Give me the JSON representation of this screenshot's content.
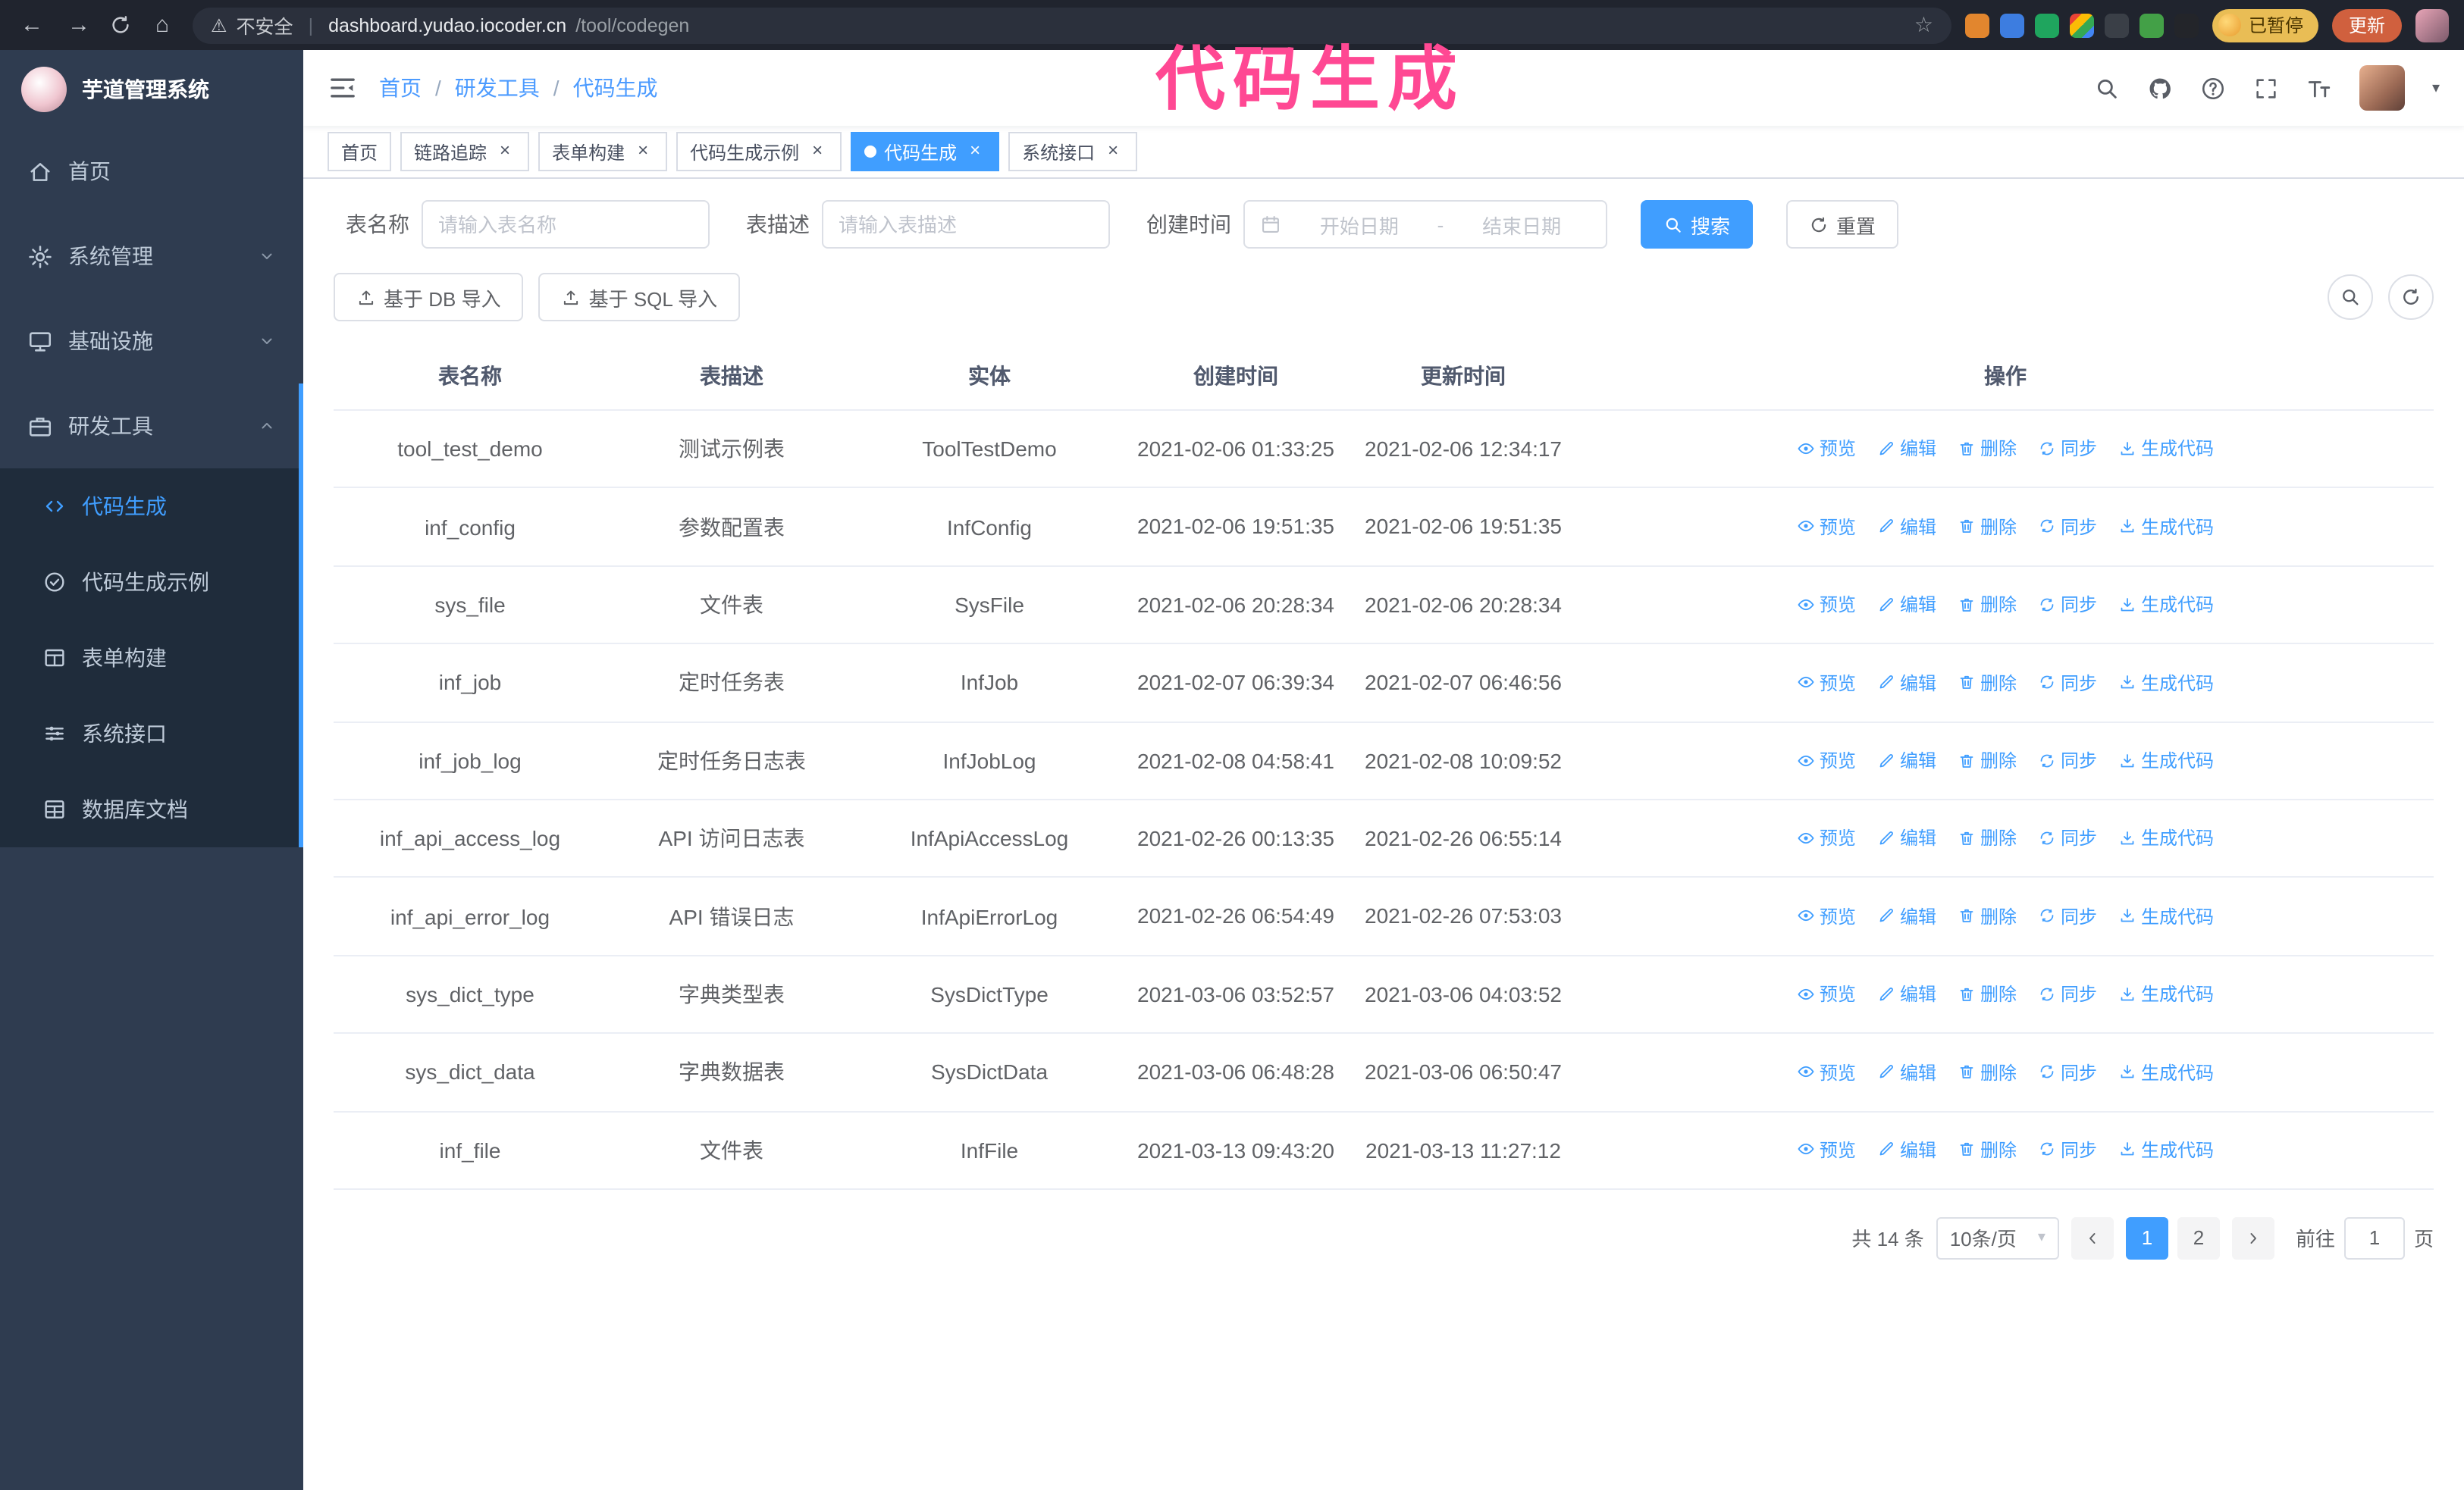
{
  "colors": {
    "accent": "#409eff",
    "annotation": "#ff4893",
    "sidebar_bg": "#2f3c50",
    "submenu_bg": "#1f2c3b",
    "chrome_bg": "#20242e"
  },
  "icons": {
    "back": "←",
    "forward": "→",
    "home": "⌂",
    "warning": "⚠",
    "star": "☆",
    "close": "×",
    "breadcrumb_separator": "/",
    "caret": "▾",
    "date_separator": "-"
  },
  "annotation": {
    "text": "代码生成"
  },
  "browser": {
    "security_label": "不安全",
    "url_host": "dashboard.yudao.iocoder.cn",
    "url_path": "/tool/codegen",
    "profile_chip": "已暂停",
    "update_button": "更新",
    "extensions": [
      {
        "name": "extension-orange",
        "color": "#e2862e"
      },
      {
        "name": "extension-blue",
        "color": "#3d7de0"
      },
      {
        "name": "extension-green-badge",
        "color": "#1fa55e"
      },
      {
        "name": "extension-multicolor",
        "color": "linear-gradient(135deg,#ea4335 25%,#fbbc05 25% 50%,#34a853 50% 75%,#4285f4 75%)"
      },
      {
        "name": "extension-dark",
        "color": "#3a3f47"
      },
      {
        "name": "extension-leaf",
        "color": "#43a047"
      },
      {
        "name": "extension-paw",
        "color": "#23252a"
      }
    ]
  },
  "sidebar": {
    "logo_title": "芋道管理系统",
    "items": [
      {
        "label": "首页"
      },
      {
        "label": "系统管理"
      },
      {
        "label": "基础设施"
      },
      {
        "label": "研发工具",
        "children": [
          {
            "label": "代码生成"
          },
          {
            "label": "代码生成示例"
          },
          {
            "label": "表单构建"
          },
          {
            "label": "系统接口"
          },
          {
            "label": "数据库文档"
          }
        ]
      }
    ]
  },
  "navbar": {
    "breadcrumb": [
      "首页",
      "研发工具",
      "代码生成"
    ]
  },
  "tags": [
    {
      "label": "首页",
      "closable": false,
      "active": false
    },
    {
      "label": "链路追踪",
      "closable": true,
      "active": false
    },
    {
      "label": "表单构建",
      "closable": true,
      "active": false
    },
    {
      "label": "代码生成示例",
      "closable": true,
      "active": false
    },
    {
      "label": "代码生成",
      "closable": true,
      "active": true
    },
    {
      "label": "系统接口",
      "closable": true,
      "active": false
    }
  ],
  "filters": {
    "table_name_label": "表名称",
    "table_name_placeholder": "请输入表名称",
    "table_desc_label": "表描述",
    "table_desc_placeholder": "请输入表描述",
    "create_time_label": "创建时间",
    "date_start_placeholder": "开始日期",
    "date_end_placeholder": "结束日期",
    "search_label": "搜索",
    "reset_label": "重置"
  },
  "toolbar": {
    "import_db_label": "基于 DB 导入",
    "import_sql_label": "基于 SQL 导入"
  },
  "table": {
    "columns": [
      "表名称",
      "表描述",
      "实体",
      "创建时间",
      "更新时间",
      "操作"
    ],
    "op_labels": [
      {
        "key": "preview",
        "label": "预览",
        "icon": "eye"
      },
      {
        "key": "edit",
        "label": "编辑",
        "icon": "edit"
      },
      {
        "key": "delete",
        "label": "删除",
        "icon": "trash"
      },
      {
        "key": "sync",
        "label": "同步",
        "icon": "sync"
      },
      {
        "key": "generate-code",
        "label": "生成代码",
        "icon": "download"
      }
    ],
    "rows": [
      {
        "name": "tool_test_demo",
        "desc": "测试示例表",
        "entity": "ToolTestDemo",
        "created": "2021-02-06 01:33:25",
        "updated": "2021-02-06 12:34:17"
      },
      {
        "name": "inf_config",
        "desc": "参数配置表",
        "entity": "InfConfig",
        "created": "2021-02-06 19:51:35",
        "updated": "2021-02-06 19:51:35"
      },
      {
        "name": "sys_file",
        "desc": "文件表",
        "entity": "SysFile",
        "created": "2021-02-06 20:28:34",
        "updated": "2021-02-06 20:28:34"
      },
      {
        "name": "inf_job",
        "desc": "定时任务表",
        "entity": "InfJob",
        "created": "2021-02-07 06:39:34",
        "updated": "2021-02-07 06:46:56"
      },
      {
        "name": "inf_job_log",
        "desc": "定时任务日志表",
        "entity": "InfJobLog",
        "created": "2021-02-08 04:58:41",
        "updated": "2021-02-08 10:09:52"
      },
      {
        "name": "inf_api_access_log",
        "desc": "API 访问日志表",
        "entity": "InfApiAccessLog",
        "created": "2021-02-26 00:13:35",
        "updated": "2021-02-26 06:55:14"
      },
      {
        "name": "inf_api_error_log",
        "desc": "API 错误日志",
        "entity": "InfApiErrorLog",
        "created": "2021-02-26 06:54:49",
        "updated": "2021-02-26 07:53:03"
      },
      {
        "name": "sys_dict_type",
        "desc": "字典类型表",
        "entity": "SysDictType",
        "created": "2021-03-06 03:52:57",
        "updated": "2021-03-06 04:03:52"
      },
      {
        "name": "sys_dict_data",
        "desc": "字典数据表",
        "entity": "SysDictData",
        "created": "2021-03-06 06:48:28",
        "updated": "2021-03-06 06:50:47"
      },
      {
        "name": "inf_file",
        "desc": "文件表",
        "entity": "InfFile",
        "created": "2021-03-13 09:43:20",
        "updated": "2021-03-13 11:27:12"
      }
    ]
  },
  "pagination": {
    "total_label": "共 14 条",
    "page_size_label": "10条/页",
    "pages": [
      "1",
      "2"
    ],
    "active_page": "1",
    "goto_label": "前往",
    "goto_value": "1",
    "goto_suffix": "页"
  }
}
